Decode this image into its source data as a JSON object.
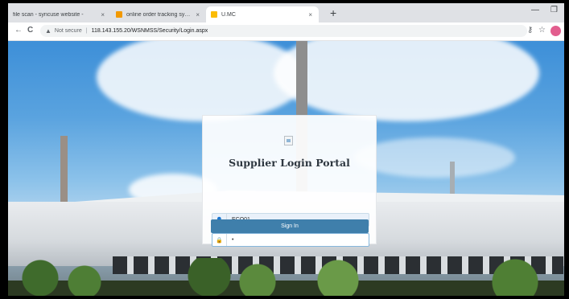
{
  "browser": {
    "tabs": [
      {
        "title": "file scan - syncuse website - ",
        "favicon_color": "#5f6368"
      },
      {
        "title": "online order tracking system",
        "favicon_color": "#f29900"
      },
      {
        "title": "U.MC",
        "favicon_color": "#fbbc04"
      }
    ],
    "new_tab_symbol": "+",
    "tab_close_symbol": "×",
    "window_controls": {
      "minimize": "—",
      "restore": "❐"
    },
    "omnibox": {
      "security_label": "Not secure",
      "url": "118.143.155.20/WSNMSS/Security/Login.aspx"
    },
    "nav_icons": {
      "back": "←",
      "reload": "C"
    },
    "right_icons": {
      "key": "⚷",
      "star": "☆"
    },
    "profile_color": "#e25d8e"
  },
  "login": {
    "title": "Supplier Login Portal",
    "username_value": "ECO01",
    "password_value": "•",
    "signin_label": "Sign In",
    "user_icon": "👤",
    "lock_icon": "🔒"
  },
  "colors": {
    "button": "#3f7fab",
    "sky": "#3d8fd8"
  }
}
